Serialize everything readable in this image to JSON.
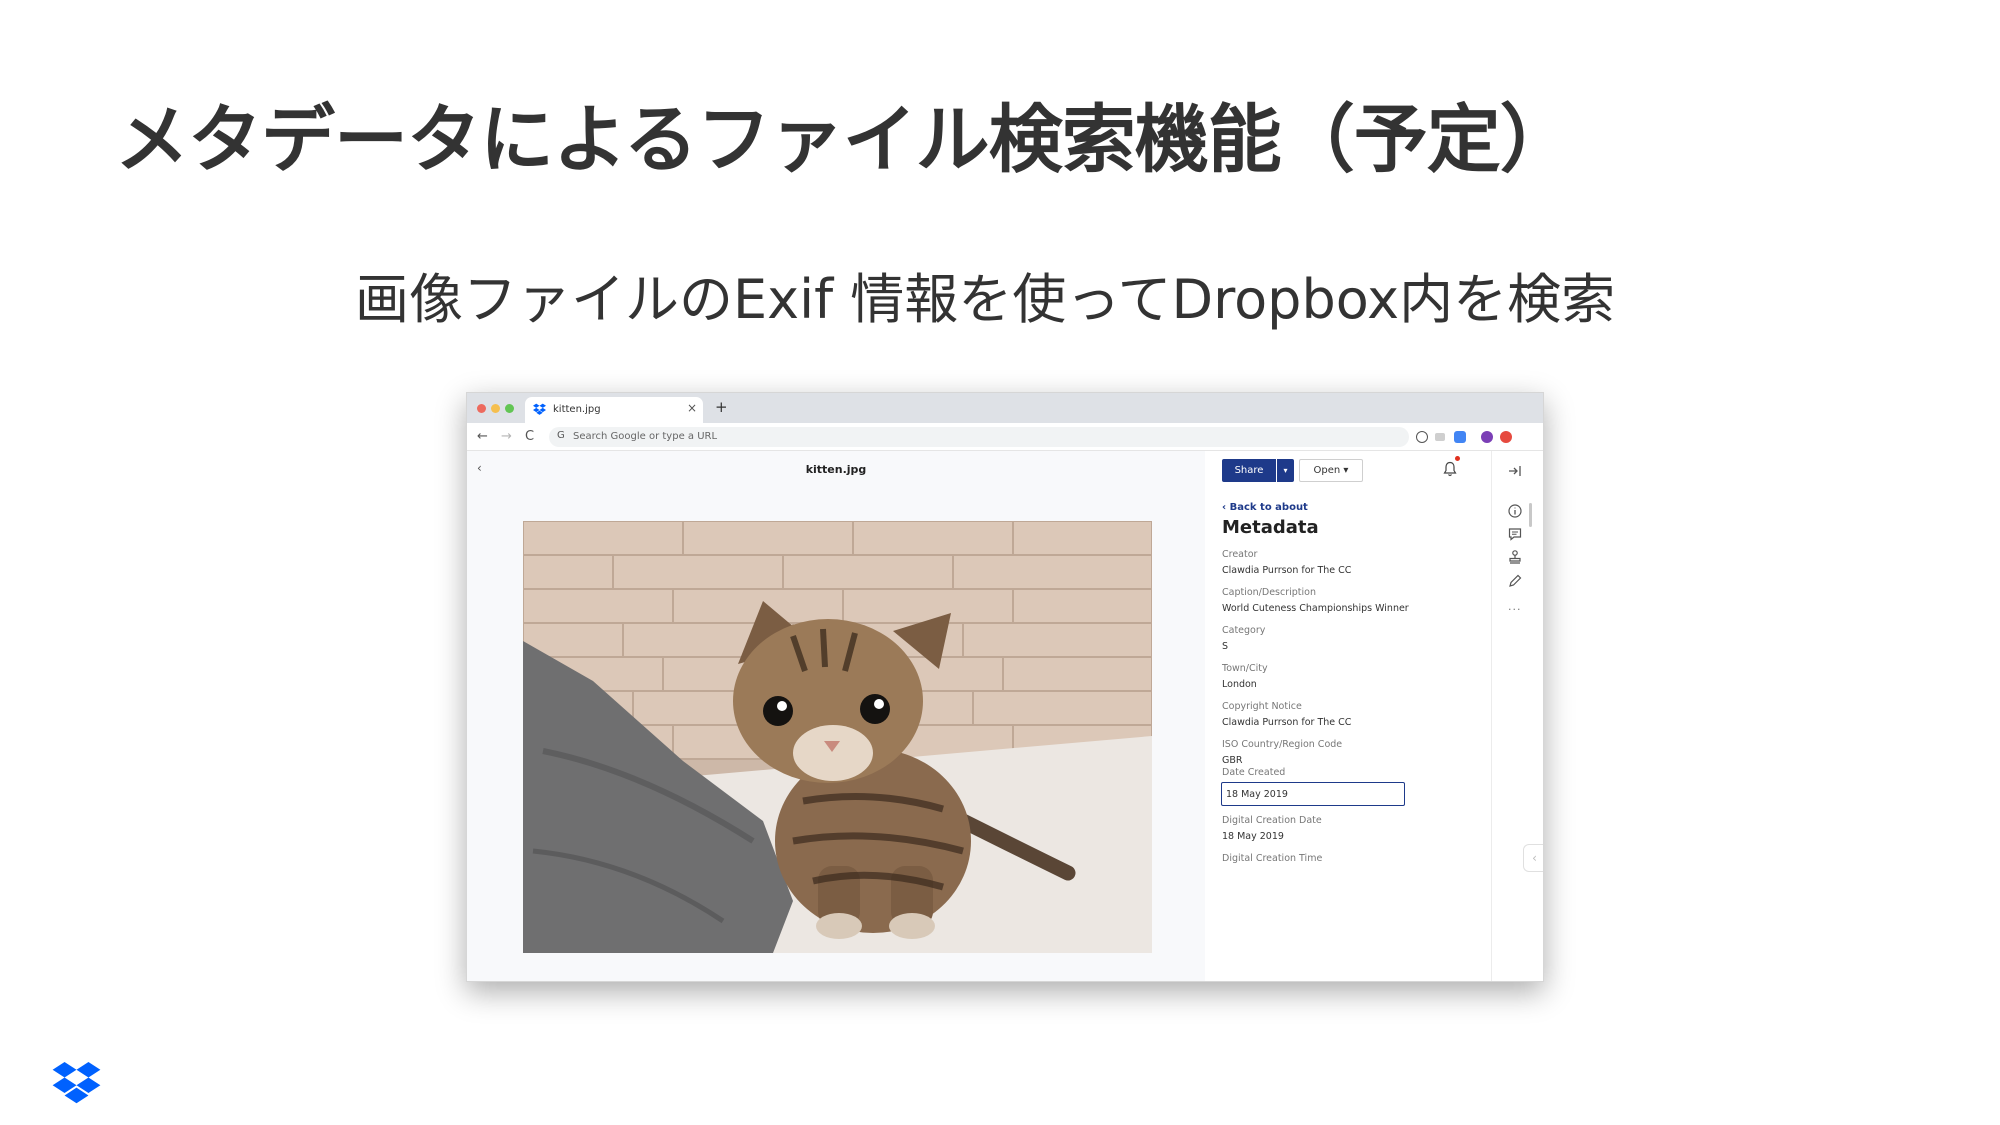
{
  "slide": {
    "title": "メタデータによるファイル検索機能（予定）",
    "subtitle": "画像ファイルのExif 情報を使ってDropbox内を検索"
  },
  "browser": {
    "tab_title": "kitten.jpg",
    "tab_close": "×",
    "new_tab": "+",
    "nav": {
      "back": "←",
      "forward": "→",
      "reload": "C"
    },
    "omnibox_g": "G",
    "omnibox_placeholder": "Search Google or type a URL"
  },
  "viewer": {
    "back": "‹",
    "filename": "kitten.jpg"
  },
  "panel": {
    "share_label": "Share",
    "share_caret": "▾",
    "open_label": "Open ▾",
    "back_link": "‹  Back to about",
    "heading": "Metadata",
    "fields": [
      {
        "label": "Creator",
        "value": "Clawdia Purrson for The CC"
      },
      {
        "label": "Caption/Description",
        "value": "World Cuteness Championships Winner"
      },
      {
        "label": "Category",
        "value": "S"
      },
      {
        "label": "Town/City",
        "value": "London"
      },
      {
        "label": "Copyright Notice",
        "value": "Clawdia Purrson for The CC"
      },
      {
        "label": "ISO Country/Region Code",
        "value": "GBR"
      },
      {
        "label": "Date Created",
        "value": "18 May 2019"
      },
      {
        "label": "Digital Creation Date",
        "value": "18 May 2019"
      },
      {
        "label": "Digital Creation Time",
        "value": ""
      }
    ],
    "rail_more": "···",
    "collapse": "‹"
  },
  "colors": {
    "title_text": "#333333",
    "brand_blue": "#0061fe",
    "share_button": "#1e3a8a",
    "notification_dot": "#e0301e"
  },
  "icons": {
    "favicon": "dropbox-icon",
    "bell": "bell-icon",
    "rail": [
      "exit-panel-icon",
      "info-icon",
      "comment-icon",
      "stamp-icon",
      "pencil-icon",
      "more-icon"
    ],
    "logo": "dropbox-logo-icon"
  }
}
